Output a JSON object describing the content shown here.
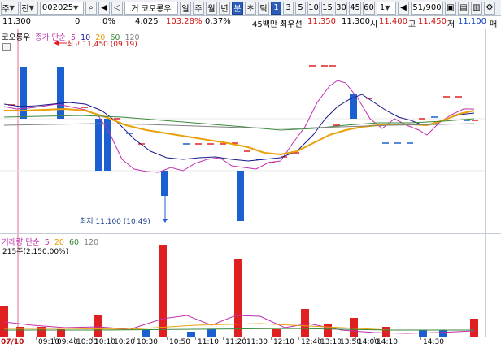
{
  "toolbar": {
    "market_label": "주",
    "type_label": "전",
    "code": "002025",
    "name_label": "거 코오롱우",
    "period_buttons": [
      "일",
      "주",
      "월",
      "년",
      "분",
      "초",
      "틱"
    ],
    "interval_buttons": [
      "1",
      "3",
      "5",
      "10",
      "15",
      "30",
      "45",
      "60"
    ],
    "interval_select": "1",
    "page_counter": "51/900"
  },
  "infobar": {
    "price": "11,300",
    "change": "0",
    "change_rate": "0%",
    "volume": "4,025",
    "volume_ratio": "103.28%",
    "turnover": "0.37%",
    "trade_value_label": "45백만",
    "stock_name": "최우선",
    "best_bid": "11,350",
    "best_ask": "11,300",
    "open_label": "시",
    "open": "11,400",
    "high_label": "고",
    "high": "11,450",
    "low_label": "저",
    "low": "11,100",
    "extra": "매"
  },
  "price_panel": {
    "name": "코오롱우",
    "ma_title": "종가 단순",
    "ma_periods": [
      "5",
      "10",
      "20",
      "60",
      "120"
    ],
    "high_annotation": "최고 11,450 (09:19)",
    "low_annotation": "최저 11,100 (10:49)"
  },
  "volume_panel": {
    "title": "거래량 단순",
    "ma_periods": [
      "5",
      "20",
      "60",
      "120"
    ],
    "max_label": "215주(2,150.00%)"
  },
  "time_axis": {
    "date": "07/10",
    "labels": [
      "09:10",
      "09:40",
      "10:00",
      "10:10",
      "10:20",
      "10:30",
      "10:50",
      "11:10",
      "11:20",
      "11:30",
      "12:10",
      "12:40",
      "13:10",
      "13:50",
      "14:00",
      "14:10",
      "14:30"
    ]
  },
  "colors": {
    "up": "#e02020",
    "down": "#1c5fd0",
    "ma5": "#c02fae",
    "ma10": "#1a1a8c",
    "ma20": "#e8a10a",
    "ma60": "#3a8a3a",
    "ma120": "#808080"
  },
  "chart_data": [
    {
      "type": "candlestick",
      "title": "코오롱우 종가 단순 5 10 20 60 120",
      "high": 11450,
      "low": 11100,
      "candles_note": "intraday 1-minute candles"
    },
    {
      "type": "bar",
      "title": "거래량 단순 5 20 60 120",
      "max_value": 215
    }
  ]
}
